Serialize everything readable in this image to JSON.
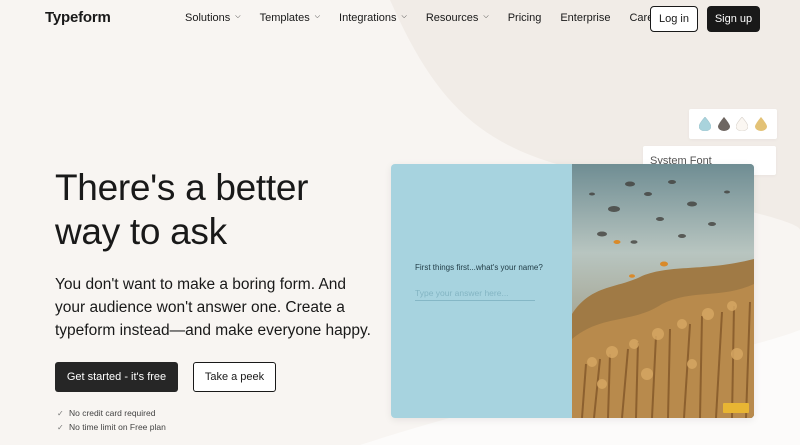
{
  "brand": {
    "logo": "Typeform"
  },
  "nav": {
    "items": [
      {
        "label": "Solutions",
        "has_dropdown": true
      },
      {
        "label": "Templates",
        "has_dropdown": true
      },
      {
        "label": "Integrations",
        "has_dropdown": true
      },
      {
        "label": "Resources",
        "has_dropdown": true
      },
      {
        "label": "Pricing",
        "has_dropdown": false
      },
      {
        "label": "Enterprise",
        "has_dropdown": false
      },
      {
        "label": "Careers",
        "has_dropdown": false
      }
    ],
    "login_label": "Log in",
    "signup_label": "Sign up"
  },
  "hero": {
    "title": "There's a better way to ask",
    "subtitle": "You don't want to make a boring form. And your audience won't answer one. Create a typeform instead—and make everyone happy.",
    "primary_cta": "Get started - it's free",
    "secondary_cta": "Take a peek",
    "checks": [
      "No credit card required",
      "No time limit on Free plan"
    ]
  },
  "preview": {
    "swatch_colors": [
      "#a9d3dc",
      "#6e6661",
      "#fbf7f2",
      "#e3c276"
    ],
    "font_label": "System Font",
    "question": "First things first...what's your name?",
    "answer_placeholder": "Type your answer here..."
  },
  "colors": {
    "background": "#f8f5f2",
    "text": "#191919",
    "form_panel": "#a7d3df",
    "accent": "#e8b533"
  }
}
